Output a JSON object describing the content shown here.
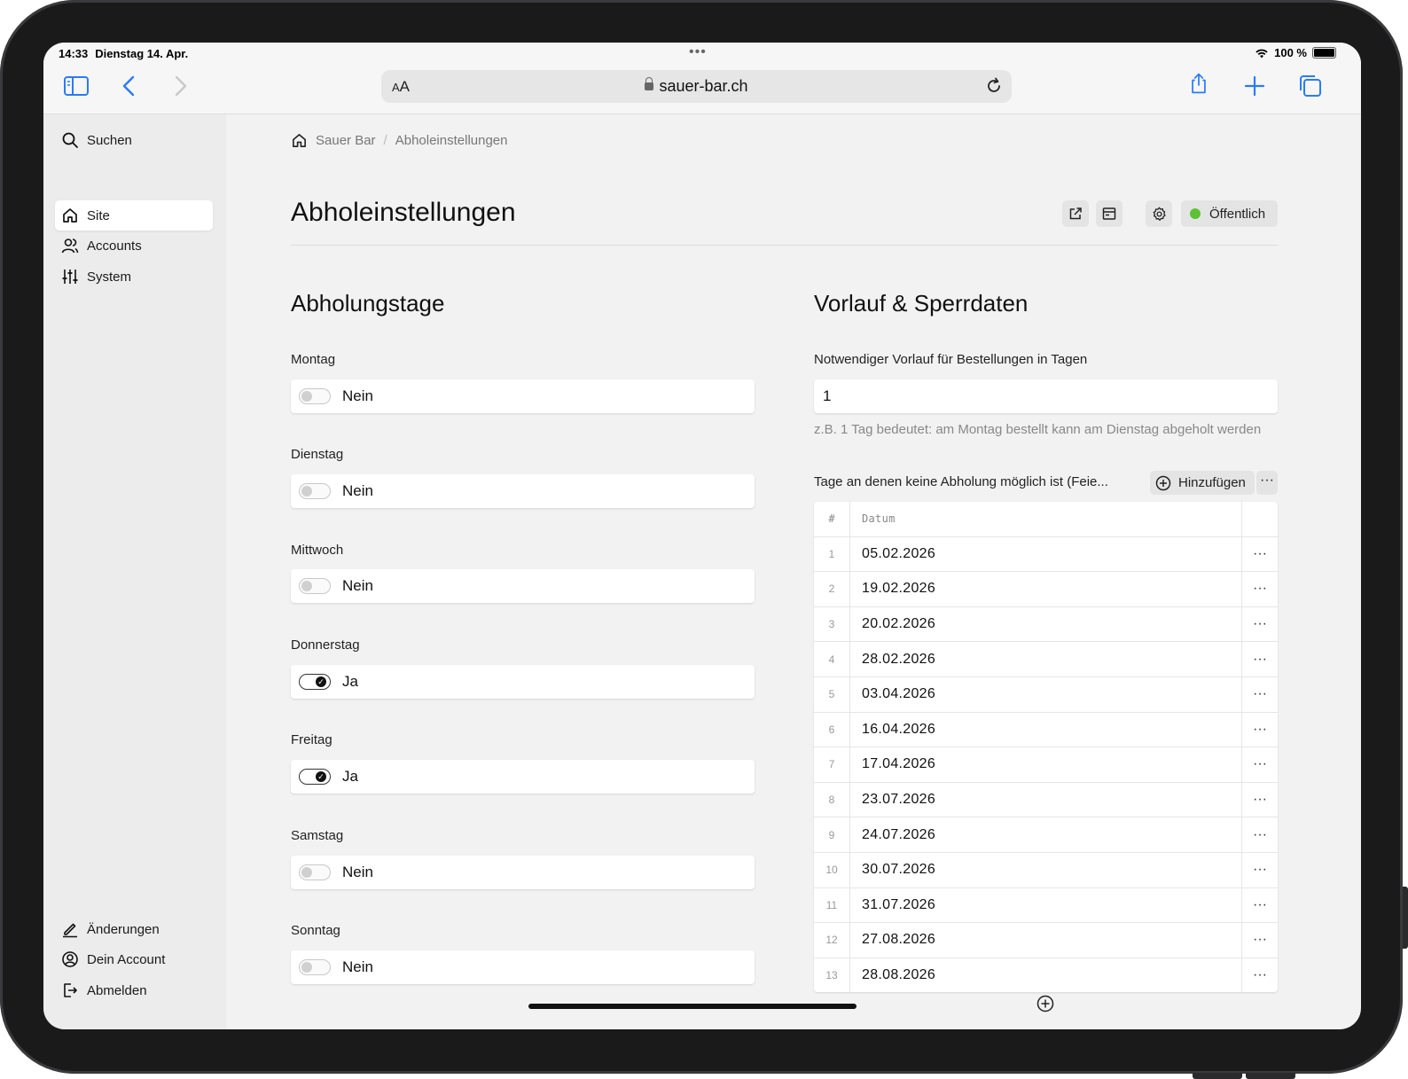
{
  "status_bar": {
    "time": "14:33",
    "date": "Dienstag 14. Apr.",
    "battery": "100 %"
  },
  "browser": {
    "url": "sauer-bar.ch",
    "text_size_small": "A",
    "text_size_large": "A"
  },
  "sidebar": {
    "search": "Suchen",
    "items": [
      {
        "label": "Site",
        "icon": "home-icon",
        "active": true
      },
      {
        "label": "Accounts",
        "icon": "users-icon"
      },
      {
        "label": "System",
        "icon": "sliders-icon"
      }
    ],
    "bottom": [
      {
        "label": "Änderungen",
        "icon": "pencil-icon"
      },
      {
        "label": "Dein Account",
        "icon": "user-circle-icon"
      },
      {
        "label": "Abmelden",
        "icon": "logout-icon"
      }
    ]
  },
  "breadcrumb": {
    "home": "Sauer Bar",
    "current": "Abholeinstellungen"
  },
  "page": {
    "title": "Abholeinstellungen",
    "status": "Öffentlich",
    "status_color": "#5bc236"
  },
  "pickup_days": {
    "title": "Abholungstage",
    "days": [
      {
        "label": "Montag",
        "value": "Nein",
        "on": false
      },
      {
        "label": "Dienstag",
        "value": "Nein",
        "on": false
      },
      {
        "label": "Mittwoch",
        "value": "Nein",
        "on": false
      },
      {
        "label": "Donnerstag",
        "value": "Ja",
        "on": true
      },
      {
        "label": "Freitag",
        "value": "Ja",
        "on": true
      },
      {
        "label": "Samstag",
        "value": "Nein",
        "on": false
      },
      {
        "label": "Sonntag",
        "value": "Nein",
        "on": false
      }
    ]
  },
  "lead": {
    "title": "Vorlauf & Sperrdaten",
    "label": "Notwendiger Vorlauf für Bestellungen in Tagen",
    "value": "1",
    "help": "z.B. 1 Tag bedeutet: am Montag bestellt kann am Dienstag abgeholt werden"
  },
  "blocked": {
    "label": "Tage an denen keine Abholung möglich ist (Feie...",
    "add_label": "Hinzufügen",
    "more": "···",
    "columns": [
      "#",
      "Datum"
    ],
    "rows": [
      {
        "n": "1",
        "date": "05.02.2026"
      },
      {
        "n": "2",
        "date": "19.02.2026"
      },
      {
        "n": "3",
        "date": "20.02.2026"
      },
      {
        "n": "4",
        "date": "28.02.2026"
      },
      {
        "n": "5",
        "date": "03.04.2026"
      },
      {
        "n": "6",
        "date": "16.04.2026"
      },
      {
        "n": "7",
        "date": "17.04.2026"
      },
      {
        "n": "8",
        "date": "23.07.2026"
      },
      {
        "n": "9",
        "date": "24.07.2026"
      },
      {
        "n": "10",
        "date": "30.07.2026"
      },
      {
        "n": "11",
        "date": "31.07.2026"
      },
      {
        "n": "12",
        "date": "27.08.2026"
      },
      {
        "n": "13",
        "date": "28.08.2026"
      }
    ]
  }
}
